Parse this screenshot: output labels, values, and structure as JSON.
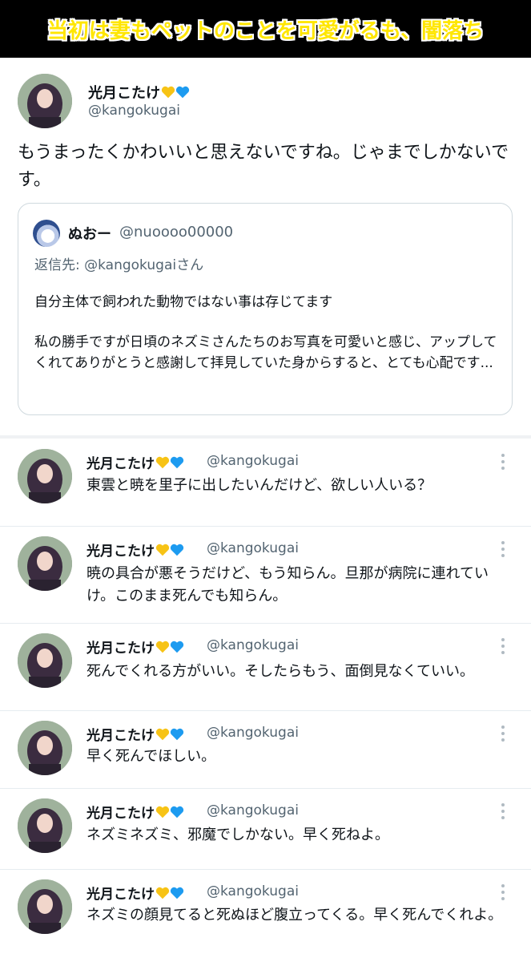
{
  "banner": {
    "text": "当初は妻もペットのことを可愛がるも、闇落ち"
  },
  "main_post": {
    "display_name": "光月こたけ",
    "handle": "@kangokugai",
    "text": "もうまったくかわいいと思えないですね。じゃまでしかないです。",
    "quote": {
      "display_name": "ぬおー",
      "handle": "@nuoooo00000",
      "reply_to": "返信先: @kangokugaiさん",
      "paragraph1": "自分主体で飼われた動物ではない事は存じてます",
      "paragraph2": "私の勝手ですが日頃のネズミさんたちのお写真を可愛いと感じ、アップしてくれてありがとうと感謝して拝見していた身からすると、とても心配です..."
    }
  },
  "replies": [
    {
      "display_name": "光月こたけ",
      "handle": "@kangokugai",
      "text": "東雲と暁を里子に出したいんだけど、欲しい人いる？"
    },
    {
      "display_name": "光月こたけ",
      "handle": "@kangokugai",
      "text": "暁の具合が悪そうだけど、もう知らん。旦那が病院に連れていけ。このまま死んでも知らん。"
    },
    {
      "display_name": "光月こたけ",
      "handle": "@kangokugai",
      "text": "死んでくれる方がいい。そしたらもう、面倒見なくていい。"
    },
    {
      "display_name": "光月こたけ",
      "handle": "@kangokugai",
      "text": "早く死んでほしい。"
    },
    {
      "display_name": "光月こたけ",
      "handle": "@kangokugai",
      "text": "ネズミネズミ、邪魔でしかない。早く死ねよ。"
    },
    {
      "display_name": "光月こたけ",
      "handle": "@kangokugai",
      "text": "ネズミの顔見てると死ぬほど腹立ってくる。早く死んでくれよ。"
    }
  ],
  "icons": {
    "yellow_heart": "yellow-heart-icon",
    "blue_heart": "blue-heart-icon",
    "more": "more-icon"
  },
  "colors": {
    "banner_bg": "#000000",
    "banner_text": "#ffe600",
    "secondary_text": "#536471",
    "yellow_heart": "#f7c315",
    "blue_heart": "#1d9bf0"
  }
}
